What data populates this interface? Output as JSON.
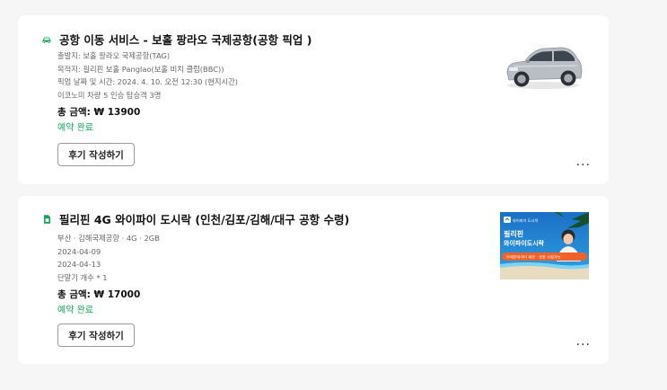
{
  "orders": [
    {
      "icon": "car-icon",
      "title": "공항 이동 서비스 - 보홀 팡라오 국제공항(공항 픽업 )",
      "details": [
        "출발지: 보홀 팡라오 국제공항(TAG)",
        "목적지: 필리핀 보홀 Panglao(보홀 비치 클럽(BBC))",
        "픽업 날짜 및 시간: 2024. 4. 10. 오전 12:30 (현지시간)",
        "이코노미 차량 5 인승 탑승객 3명"
      ],
      "total": "총 금액: ₩ 13900",
      "status": "예약 완료",
      "review_button": "후기 작성하기",
      "more": "···"
    },
    {
      "icon": "sim-card-icon",
      "title": "필리핀 4G 와이파이 도시락 (인천/김포/김해/대구 공항 수령)",
      "details": [
        "부산 · 김해국제공항 · 4G · 2GB",
        "2024-04-09",
        "2024-04-13",
        "단말기 개수 * 1"
      ],
      "total": "총 금액: ₩ 17000",
      "status": "예약 완료",
      "review_button": "후기 작성하기",
      "more": "···",
      "thumb": {
        "brand": "와이파이 도시락",
        "line1": "필리핀",
        "line2": "와이파이도시락",
        "banner": "무제한데이터 제공 · 공항 수령가능"
      }
    }
  ],
  "colors": {
    "status_green": "#1aa35c",
    "icon_green": "#1aa35c",
    "thumb_blue": "#1d7fd0",
    "thumb_orange": "#f1612a"
  }
}
